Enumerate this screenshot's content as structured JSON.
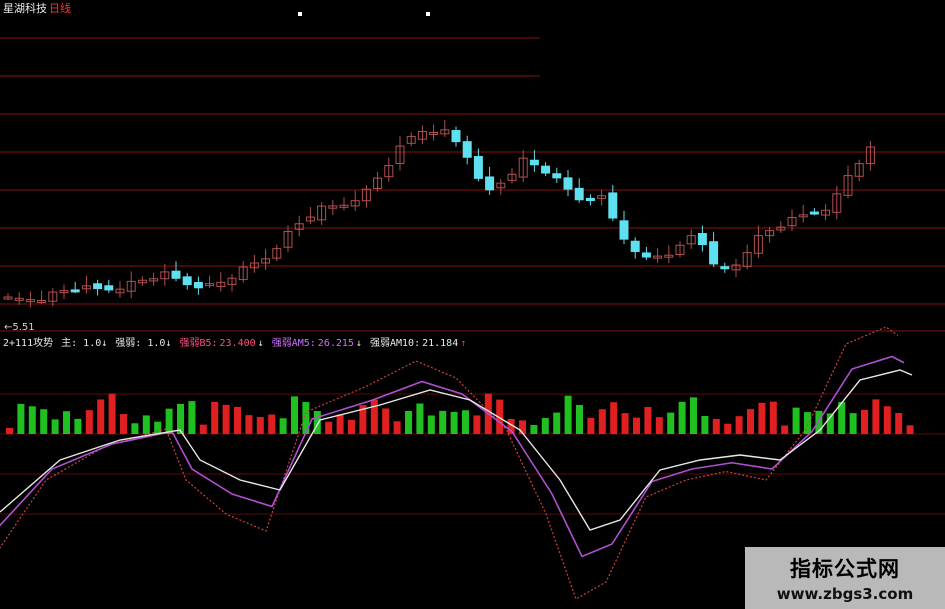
{
  "header": {
    "stock_name": "星湖科技",
    "period": "日线"
  },
  "price_panel": {
    "low_marker": "←5.51",
    "colors": {
      "up": "#b05050",
      "down": "#5fe0f0",
      "grid": "#8a1010"
    }
  },
  "indicator_bar": {
    "formula_name": "2+111攻势",
    "main_label": "主: 1.0↓",
    "strength_label": "强弱: 1.0↓",
    "ma5_label": "强弱B5:",
    "ma5_value": "23.400",
    "ma5_arrow": "↓",
    "am5_label": "强弱AM5:",
    "am5_value": "26.215",
    "am5_arrow": "↓",
    "am10_label": "强弱AM10:",
    "am10_value": "21.184",
    "am10_arrow": "↑"
  },
  "watermark": {
    "title": "指标公式网",
    "url": "www.zbgs3.com"
  }
}
